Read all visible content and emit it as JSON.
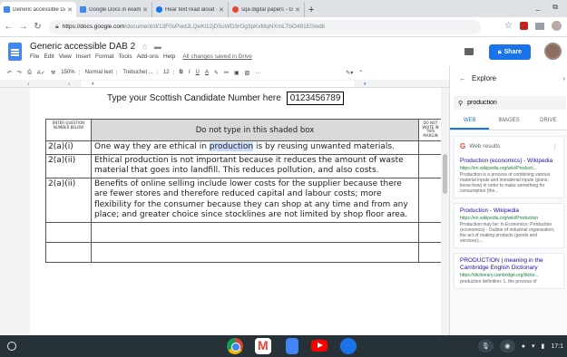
{
  "tabs": [
    {
      "label": "Generic accessible DAB 2 - Goo",
      "fav": "#4285f4",
      "active": true
    },
    {
      "label": "Google Docs in exams - Google",
      "fav": "#4285f4",
      "active": false
    },
    {
      "label": "Hear text read aloud - Chromeb",
      "fav": "#1a73e8",
      "active": false
    },
    {
      "label": "sqa digital papers - Google Sear",
      "fav": "#ea4335",
      "active": false
    }
  ],
  "browser": {
    "url_host": "https://docs.google.com",
    "url_path": "/document/d/13F0sPwdJLQeKl12jD5uWD3rOg3pKxMqNXmLTbO481E0/edit",
    "new_tab": "+",
    "win_controls": "_ ⧉"
  },
  "doc": {
    "title": "Generic accessible DAB 2",
    "menus": [
      "File",
      "Edit",
      "View",
      "Insert",
      "Format",
      "Tools",
      "Add-ons",
      "Help"
    ],
    "saved_status": "All changes saved in Drive",
    "share_label": "Share"
  },
  "toolbar": {
    "zoom": "150%",
    "style": "Normal text",
    "font": "Trebuchet ...",
    "size": "12",
    "bold": "B",
    "italic": "I",
    "underline": "U",
    "text_color": "A",
    "more": "⋯"
  },
  "page": {
    "candidate_prompt": "Type your Scottish Candidate Number here",
    "candidate_number": "0123456789",
    "table": {
      "col1_header": "ENTER QUESTION NUMBER BELOW",
      "shaded_header": "Do not type in this shaded box",
      "col3_header": "DO NOT WRITE IN THIS MARGIN",
      "rows": [
        {
          "q": "2(a)(i)",
          "before": "One way they are ethical in ",
          "highlight": "production",
          "after": " is by reusing unwanted materials."
        },
        {
          "q": "2(a)(ii)",
          "before": "Ethical  production is not important because it reduces the amount of waste material that goes into landfill. This reduces pollution, and also costs.",
          "highlight": "",
          "after": ""
        },
        {
          "q": "2(a)(ii)",
          "before": "Benefits of online selling include lower costs for the supplier because there are fewer stores and therefore reduced capital and labour costs; more flexibility for the consumer because they can shop at any time and from any place; and greater choice since stocklines are not limited by shop floor area.",
          "highlight": "",
          "after": ""
        }
      ]
    }
  },
  "explore": {
    "title": "Explore",
    "search_value": "production",
    "tabs": [
      "WEB",
      "IMAGES",
      "DRIVE"
    ],
    "web_results_label": "Web results",
    "results": [
      {
        "title": "Production (economics) - Wikipedia",
        "url": "https://en.wikipedia.org/wiki/Producti...",
        "snippet": "Production is a process of combining various material inputs and immaterial inputs (plans, know-how) in order to make something for consumption (the..."
      },
      {
        "title": "Production - Wikipedia",
        "url": "https://en.wikipedia.org/wiki/Production",
        "snippet": "Production may be: In Economics: Production (economics) · Outline of industrial organization, the act of making products (goods and services);..."
      },
      {
        "title": "PRODUCTION | meaning in the Cambridge English Dictionary",
        "url": "https://dictionary.cambridge.org/dictio...",
        "snippet": "production definition: 1. the process of"
      }
    ]
  },
  "shelf": {
    "time": "17:1"
  }
}
